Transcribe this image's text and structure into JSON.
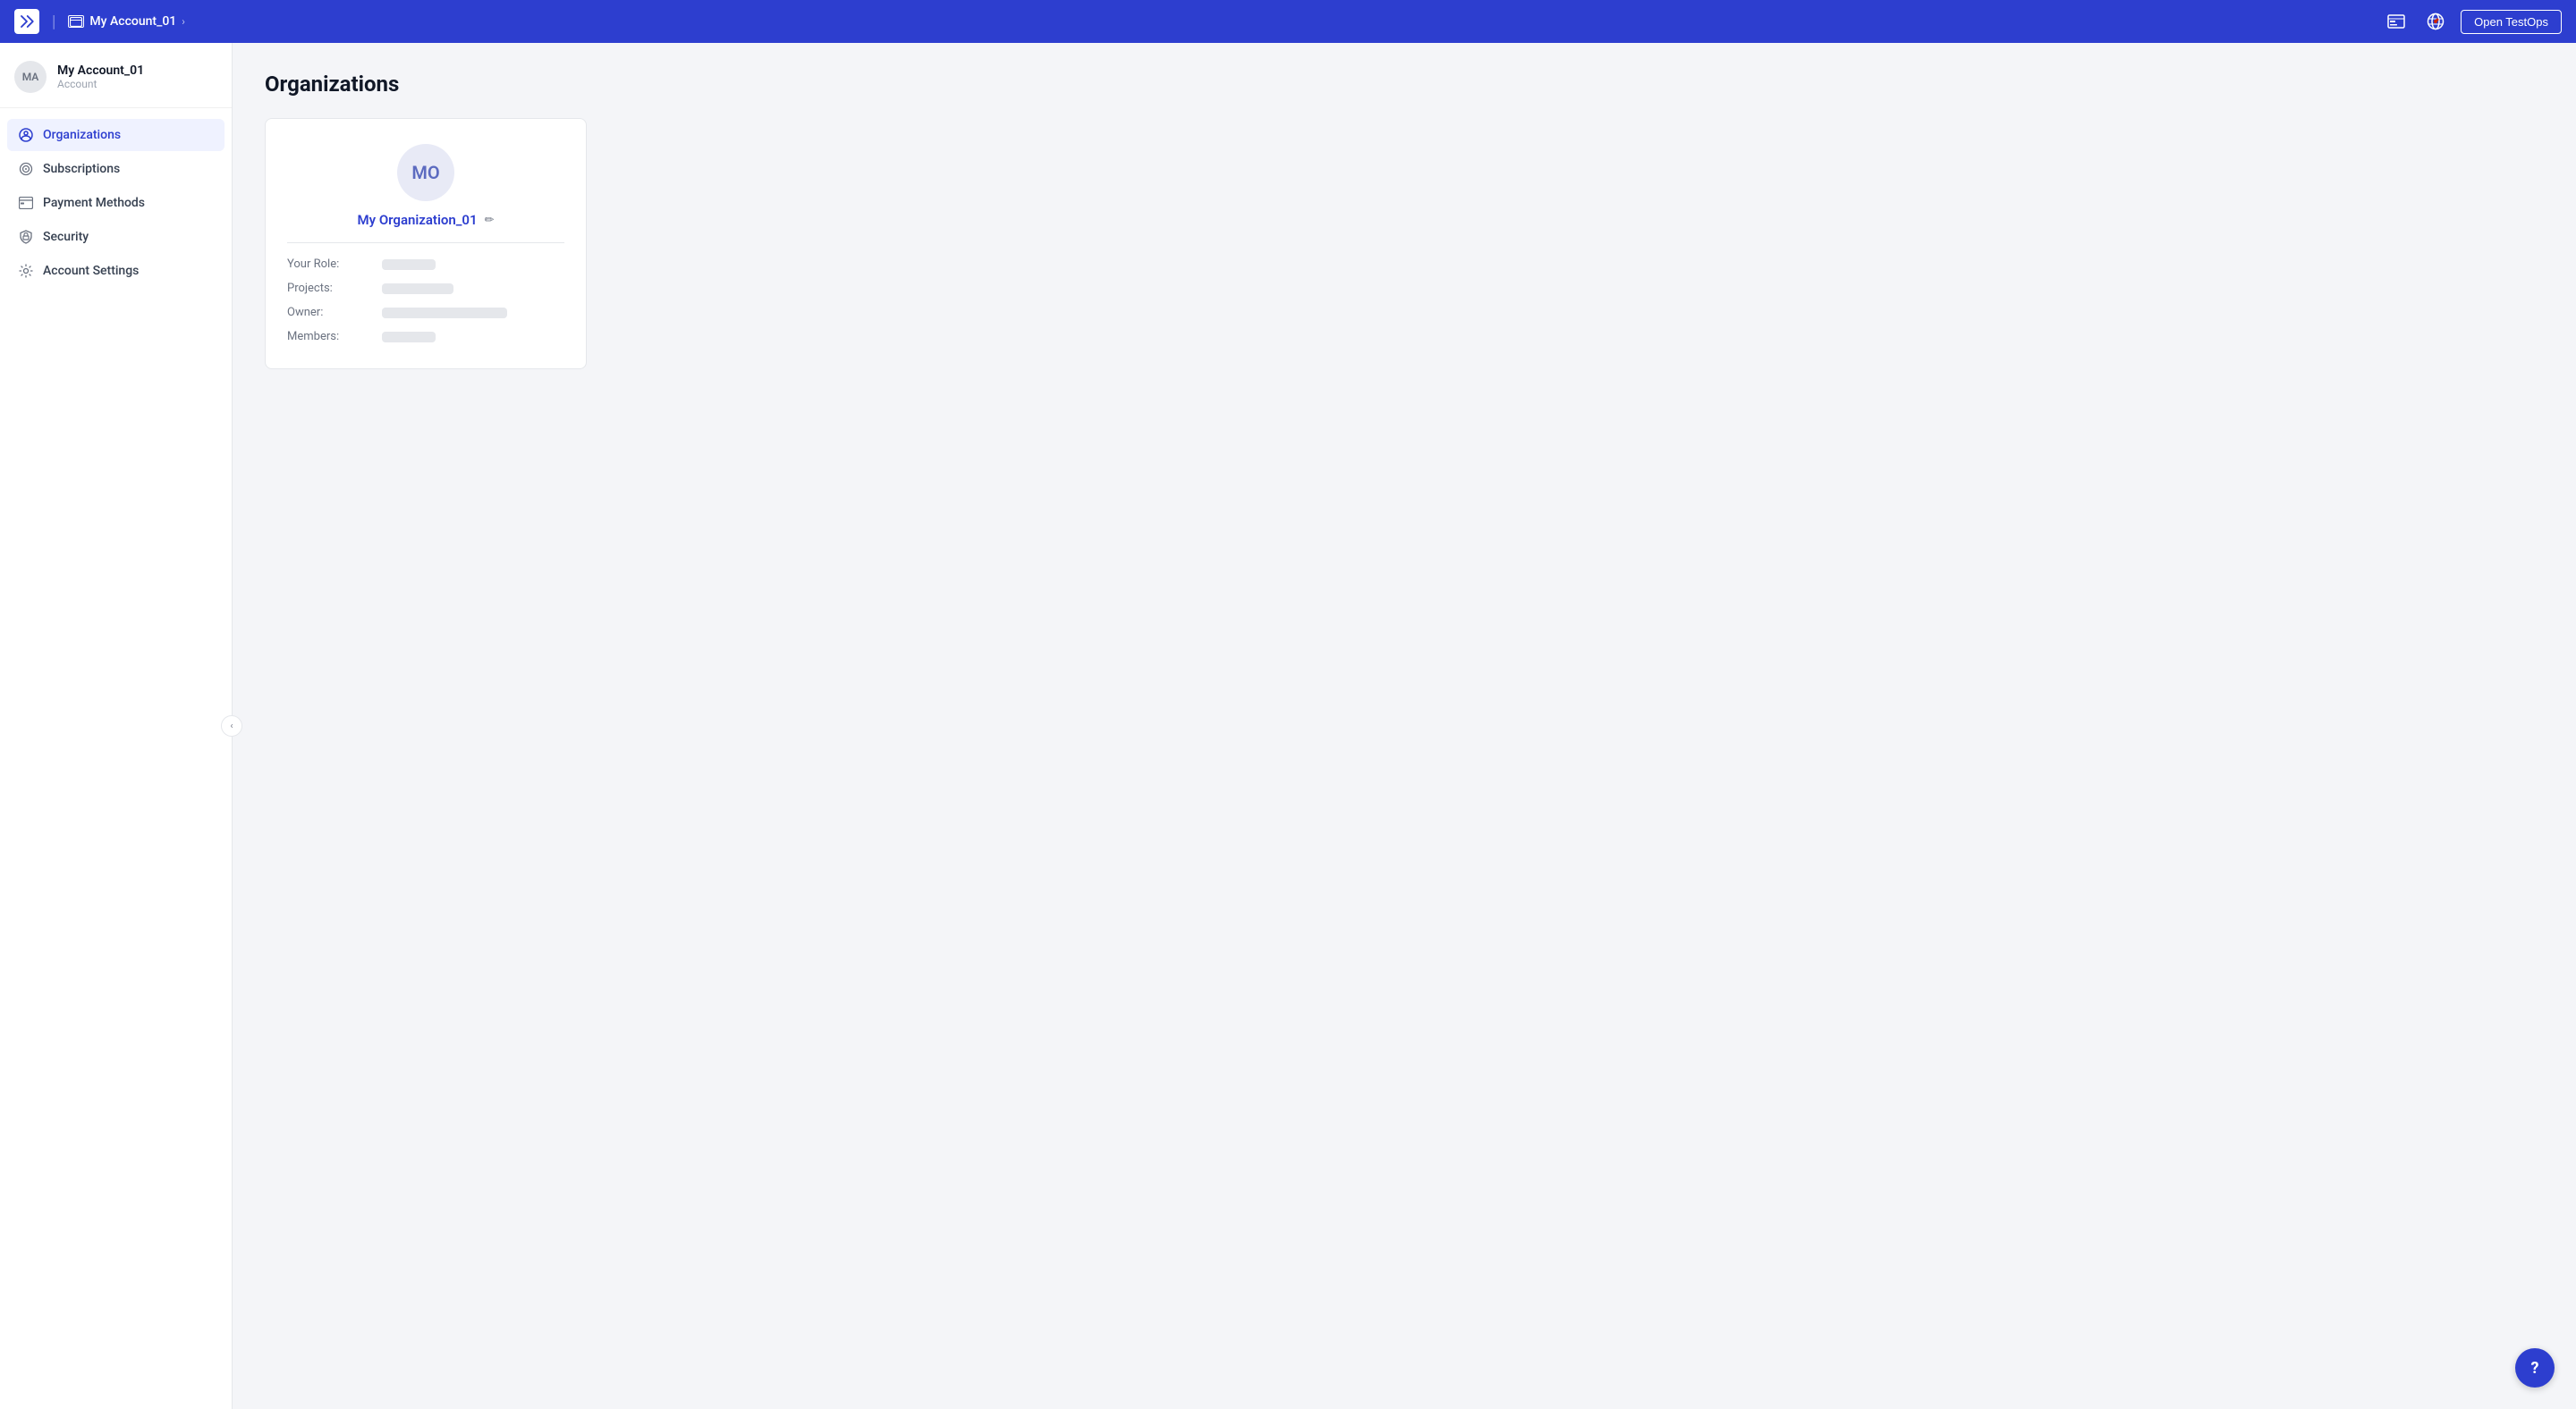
{
  "topnav": {
    "logo_alt": "Katalon",
    "account_icon": "☰",
    "account_name": "My Account_01",
    "chevron": "›",
    "divider": "|",
    "open_testops_label": "Open TestOps",
    "notification_icon": "≡",
    "globe_icon": "🌐",
    "help_icon": "?"
  },
  "sidebar": {
    "avatar_initials": "MA",
    "account_name": "My Account_01",
    "account_type": "Account",
    "collapse_icon": "‹",
    "items": [
      {
        "id": "organizations",
        "label": "Organizations",
        "icon": "org",
        "active": true
      },
      {
        "id": "subscriptions",
        "label": "Subscriptions",
        "icon": "sub",
        "active": false
      },
      {
        "id": "payment-methods",
        "label": "Payment Methods",
        "icon": "pay",
        "active": false
      },
      {
        "id": "security",
        "label": "Security",
        "icon": "sec",
        "active": false
      },
      {
        "id": "account-settings",
        "label": "Account Settings",
        "icon": "set",
        "active": false
      }
    ]
  },
  "main": {
    "page_title": "Organizations",
    "org_card": {
      "avatar_initials": "MO",
      "org_name": "My Organization_01",
      "edit_icon": "✏",
      "fields": [
        {
          "label": "Your Role:",
          "skeleton_class": "skeleton-short"
        },
        {
          "label": "Projects:",
          "skeleton_class": "skeleton-medium"
        },
        {
          "label": "Owner:",
          "skeleton_class": "skeleton-long"
        },
        {
          "label": "Members:",
          "skeleton_class": "skeleton-short"
        }
      ]
    }
  },
  "help_button_label": "?"
}
